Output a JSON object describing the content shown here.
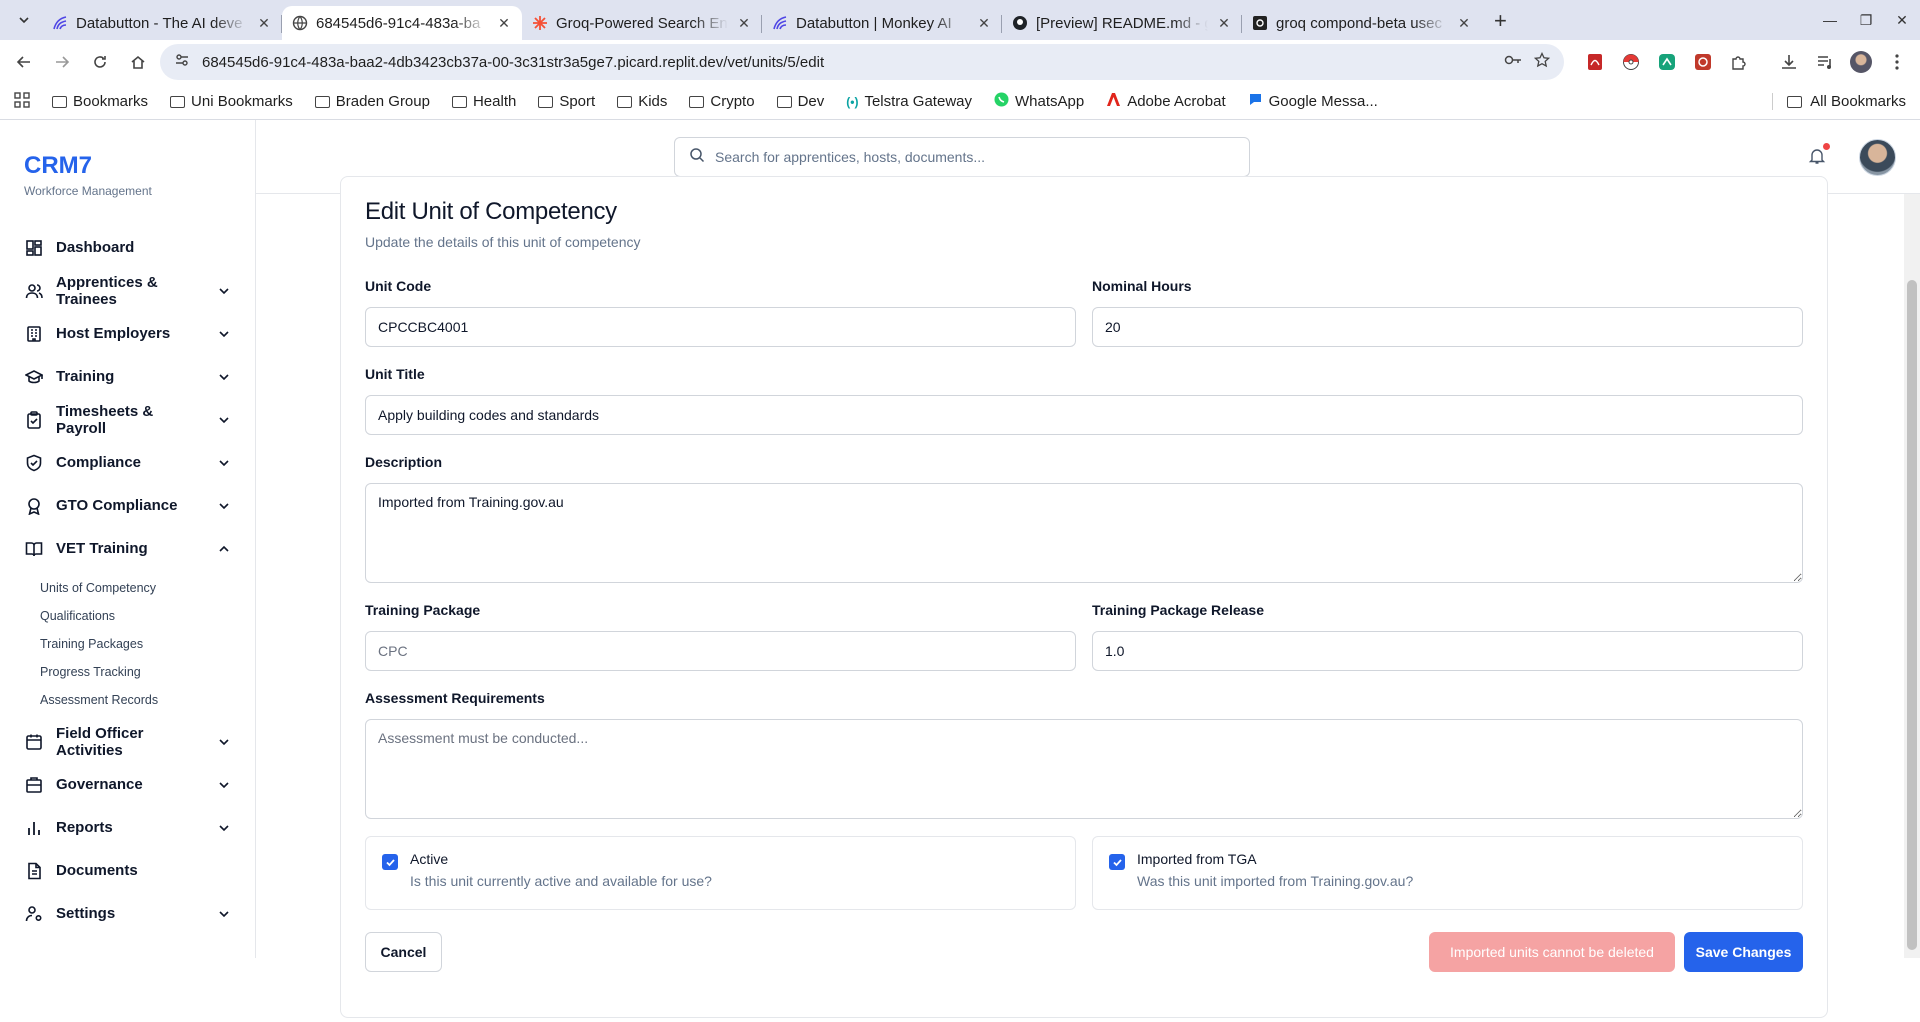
{
  "browser": {
    "tabs": [
      {
        "title": "Databutton - The AI deve",
        "icon": "databutton-icon"
      },
      {
        "title": "684545d6-91c4-483a-ba",
        "icon": "globe-icon",
        "active": true
      },
      {
        "title": "Groq-Powered Search En",
        "icon": "groq-icon"
      },
      {
        "title": "Databutton | Monkey AI",
        "icon": "databutton-icon"
      },
      {
        "title": "[Preview] README.md - g",
        "icon": "github-icon"
      },
      {
        "title": "groq compond-beta usec",
        "icon": "groq-icon"
      }
    ],
    "url": "684545d6-91c4-483a-baa2-4db3423cb37a-00-3c31str3a5ge7.picard.replit.dev/vet/units/5/edit",
    "bookmarks": [
      "Bookmarks",
      "Uni Bookmarks",
      "Braden Group",
      "Health",
      "Sport",
      "Kids",
      "Crypto",
      "Dev",
      "Telstra Gateway",
      "WhatsApp",
      "Adobe Acrobat",
      "Google Messa..."
    ],
    "all_bookmarks": "All Bookmarks"
  },
  "brand": {
    "name": "CRM7",
    "subtitle": "Workforce Management"
  },
  "nav": {
    "items": [
      {
        "label": "Dashboard",
        "icon": "dashboard-icon",
        "chevron": false
      },
      {
        "label": "Apprentices & Trainees",
        "icon": "users-icon",
        "chevron": true
      },
      {
        "label": "Host Employers",
        "icon": "building-icon",
        "chevron": true
      },
      {
        "label": "Training",
        "icon": "graduation-cap-icon",
        "chevron": true
      },
      {
        "label": "Timesheets & Payroll",
        "icon": "clipboard-check-icon",
        "chevron": true
      },
      {
        "label": "Compliance",
        "icon": "shield-check-icon",
        "chevron": true
      },
      {
        "label": "GTO Compliance",
        "icon": "award-icon",
        "chevron": true
      },
      {
        "label": "VET Training",
        "icon": "book-open-icon",
        "chevron": true,
        "expanded": true
      },
      {
        "label": "Field Officer Activities",
        "icon": "calendar-icon",
        "chevron": true
      },
      {
        "label": "Governance",
        "icon": "landmark-icon",
        "chevron": true
      },
      {
        "label": "Reports",
        "icon": "bar-chart-icon",
        "chevron": true
      },
      {
        "label": "Documents",
        "icon": "file-icon",
        "chevron": false
      },
      {
        "label": "Settings",
        "icon": "user-cog-icon",
        "chevron": true
      }
    ],
    "vet_sub": [
      "Units of Competency",
      "Qualifications",
      "Training Packages",
      "Progress Tracking",
      "Assessment Records"
    ]
  },
  "search": {
    "placeholder": "Search for apprentices, hosts, documents..."
  },
  "form": {
    "title": "Edit Unit of Competency",
    "subtitle": "Update the details of this unit of competency",
    "unit_code": {
      "label": "Unit Code",
      "value": "CPCCBC4001"
    },
    "nominal_hours": {
      "label": "Nominal Hours",
      "value": "20"
    },
    "unit_title": {
      "label": "Unit Title",
      "value": "Apply building codes and standards"
    },
    "description": {
      "label": "Description",
      "value": "Imported from Training.gov.au"
    },
    "training_package": {
      "label": "Training Package",
      "value": "",
      "placeholder": "CPC"
    },
    "training_package_release": {
      "label": "Training Package Release",
      "value": "1.0"
    },
    "assessment": {
      "label": "Assessment Requirements",
      "value": "",
      "placeholder": "Assessment must be conducted..."
    },
    "active": {
      "label": "Active",
      "description": "Is this unit currently active and available for use?",
      "checked": true
    },
    "imported": {
      "label": "Imported from TGA",
      "description": "Was this unit imported from Training.gov.au?",
      "checked": true
    },
    "cancel_label": "Cancel",
    "delete_label": "Imported units cannot be deleted",
    "save_label": "Save Changes"
  },
  "colors": {
    "accent": "#2563eb",
    "disabled_danger": "#f5a3a3",
    "notification": "#ef4444"
  }
}
